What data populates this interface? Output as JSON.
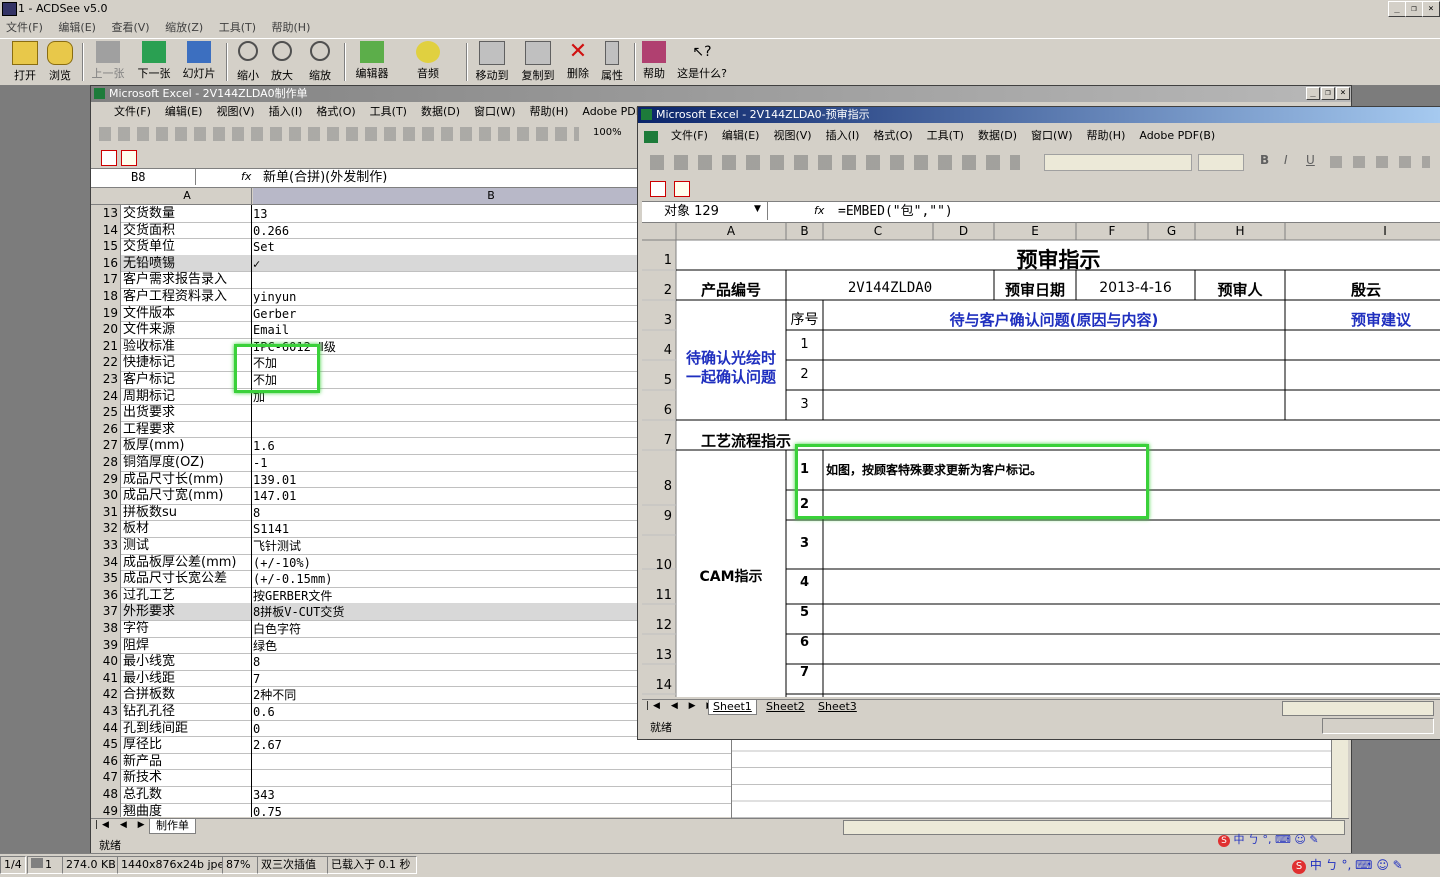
{
  "acdsee": {
    "title": "1 - ACDSee v5.0",
    "menu": [
      "文件(F)",
      "编辑(E)",
      "查看(V)",
      "缩放(Z)",
      "工具(T)",
      "帮助(H)"
    ],
    "toolbar": [
      "打开",
      "浏览",
      "上一张",
      "下一张",
      "幻灯片",
      "缩小",
      "放大",
      "缩放",
      "编辑器",
      "音频",
      "移动到",
      "复制到",
      "删除",
      "属性",
      "帮助",
      "这是什么?"
    ],
    "status": [
      "1/4",
      "1",
      "274.0 KB",
      "1440x876x24b jpeg",
      "87%",
      "双三次插值",
      "已载入于 0.1 秒"
    ]
  },
  "excel1": {
    "title": "Microsoft Excel - 2V144ZLDA0制作单",
    "menu": [
      "文件(F)",
      "编辑(E)",
      "视图(V)",
      "插入(I)",
      "格式(O)",
      "工具(T)",
      "数据(D)",
      "窗口(W)",
      "帮助(H)",
      "Adobe PDF(B)"
    ],
    "zoom": "100%",
    "name_box": "B8",
    "formula": "新单(合拼)(外发制作)",
    "col_a": "A",
    "col_b": "B",
    "rows": [
      {
        "n": "13",
        "a": "交货数量",
        "b": "13"
      },
      {
        "n": "14",
        "a": "交货面积",
        "b": "0.266"
      },
      {
        "n": "15",
        "a": "交货单位",
        "b": "Set"
      },
      {
        "n": "16",
        "a": "无铅喷锡",
        "b": "✓"
      },
      {
        "n": "17",
        "a": "客户需求报告录入",
        "b": ""
      },
      {
        "n": "18",
        "a": "客户工程资料录入",
        "b": "yinyun"
      },
      {
        "n": "19",
        "a": "文件版本",
        "b": "Gerber"
      },
      {
        "n": "20",
        "a": "文件来源",
        "b": "Email"
      },
      {
        "n": "21",
        "a": "验收标准",
        "b": "IPC-6012 Ⅱ级"
      },
      {
        "n": "22",
        "a": "快捷标记",
        "b": "不加"
      },
      {
        "n": "23",
        "a": "客户标记",
        "b": "不加"
      },
      {
        "n": "24",
        "a": "周期标记",
        "b": "加"
      },
      {
        "n": "25",
        "a": "出货要求",
        "b": ""
      },
      {
        "n": "26",
        "a": "工程要求",
        "b": ""
      },
      {
        "n": "27",
        "a": "板厚(mm)",
        "b": "1.6"
      },
      {
        "n": "28",
        "a": "铜箔厚度(OZ)",
        "b": "-1"
      },
      {
        "n": "29",
        "a": "成品尺寸长(mm)",
        "b": "139.01"
      },
      {
        "n": "30",
        "a": "成品尺寸宽(mm)",
        "b": "147.01"
      },
      {
        "n": "31",
        "a": "拼板数su",
        "b": "8"
      },
      {
        "n": "32",
        "a": "板材",
        "b": "S1141"
      },
      {
        "n": "33",
        "a": "测试",
        "b": "飞针测试"
      },
      {
        "n": "34",
        "a": "成品板厚公差(mm)",
        "b": "(+/-10%)"
      },
      {
        "n": "35",
        "a": "成品尺寸长宽公差",
        "b": "(+/-0.15mm)"
      },
      {
        "n": "36",
        "a": "过孔工艺",
        "b": "按GERBER文件"
      },
      {
        "n": "37",
        "a": "外形要求",
        "b": "8拼板V-CUT交货"
      },
      {
        "n": "38",
        "a": "字符",
        "b": "白色字符"
      },
      {
        "n": "39",
        "a": "阻焊",
        "b": "绿色"
      },
      {
        "n": "40",
        "a": "最小线宽",
        "b": "8"
      },
      {
        "n": "41",
        "a": "最小线距",
        "b": "7"
      },
      {
        "n": "42",
        "a": "合拼板数",
        "b": "2种不同"
      },
      {
        "n": "43",
        "a": "钻孔孔径",
        "b": "0.6"
      },
      {
        "n": "44",
        "a": "孔到线间距",
        "b": "0"
      },
      {
        "n": "45",
        "a": "厚径比",
        "b": "2.67"
      },
      {
        "n": "46",
        "a": "新产品",
        "b": ""
      },
      {
        "n": "47",
        "a": "新技术",
        "b": ""
      },
      {
        "n": "48",
        "a": "总孔数",
        "b": "343"
      },
      {
        "n": "49",
        "a": "翘曲度",
        "b": "0.75"
      }
    ],
    "sheet_tab": "制作单",
    "status": "就绪"
  },
  "excel2": {
    "title": "Microsoft Excel - 2V144ZLDA0-预审指示",
    "menu": [
      "文件(F)",
      "编辑(E)",
      "视图(V)",
      "插入(I)",
      "格式(O)",
      "工具(T)",
      "数据(D)",
      "窗口(W)",
      "帮助(H)",
      "Adobe PDF(B)"
    ],
    "name_box": "对象 129",
    "formula": "=EMBED(\"包\",\"\")",
    "cols": [
      "A",
      "B",
      "C",
      "D",
      "E",
      "F",
      "G",
      "H",
      "I"
    ],
    "sheet_title": "预审指示",
    "product_label": "产品编号",
    "product_code": "2V144ZLDA0",
    "date_label": "预审日期",
    "date_value": "2013-4-16",
    "reviewer_label": "预审人",
    "reviewer": "殷云",
    "seq_label": "序号",
    "confirm_header": "待与客户确认问题(原因与内容)",
    "suggest_header": "预审建议",
    "pending_label_1": "待确认光绘时",
    "pending_label_2": "一起确认问题",
    "process_label": "工艺流程指示",
    "cam_label": "CAM指示",
    "cam_note": "如图，按顾客特殊要求更新为客户标记。",
    "seq_pending": [
      "1",
      "2",
      "3"
    ],
    "seq_cam": [
      "1",
      "2",
      "3",
      "4",
      "5",
      "6",
      "7"
    ],
    "rownums": [
      "1",
      "2",
      "3",
      "4",
      "5",
      "6",
      "7",
      "8",
      "9",
      "10",
      "11",
      "12",
      "13",
      "14"
    ],
    "tabs": [
      "Sheet1",
      "Sheet2",
      "Sheet3"
    ],
    "status": "就绪"
  },
  "ime": [
    "中",
    "ㄅ",
    "°,"
  ]
}
